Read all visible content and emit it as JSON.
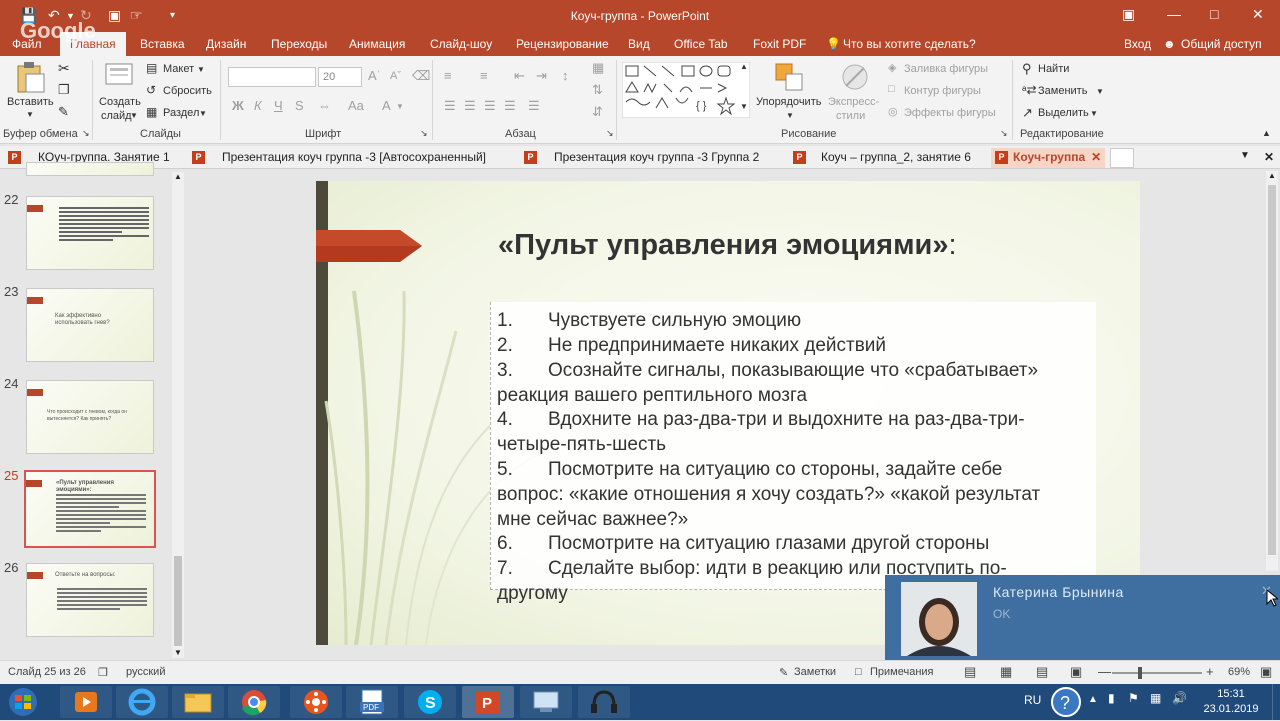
{
  "window": {
    "title": "Коуч-группа - PowerPoint"
  },
  "quick_access": {
    "google_watermark": "Google"
  },
  "menu": {
    "items": [
      "Файл",
      "Главная",
      "Вставка",
      "Дизайн",
      "Переходы",
      "Анимация",
      "Слайд-шоу",
      "Рецензирование",
      "Вид",
      "Office Tab",
      "Foxit PDF"
    ],
    "tell_me": "Что вы хотите сделать?",
    "signin": "Вход",
    "share": "Общий доступ"
  },
  "ribbon": {
    "clipboard": {
      "paste": "Вставить",
      "group": "Буфер обмена"
    },
    "slides": {
      "new_slide": "Создать",
      "new_slide2": "слайд",
      "layout": "Макет",
      "reset": "Сбросить",
      "section": "Раздел",
      "group": "Слайды"
    },
    "font": {
      "font_size": "20",
      "bold": "Ж",
      "italic": "К",
      "underline": "Ч",
      "strike": "S",
      "group": "Шрифт"
    },
    "paragraph": {
      "group": "Абзац"
    },
    "drawing": {
      "arrange": "Упорядочить",
      "quick_styles": "Экспресс-",
      "quick_styles2": "стили",
      "fill": "Заливка фигуры",
      "outline": "Контур фигуры",
      "effects": "Эффекты фигуры",
      "group": "Рисование"
    },
    "editing": {
      "find": "Найти",
      "replace": "Заменить",
      "select": "Выделить",
      "group": "Редактирование"
    }
  },
  "doc_tabs": [
    {
      "label": "КОуч-группа. Занятие 1"
    },
    {
      "label": "Презентация коуч группа -3 [Автосохраненный]"
    },
    {
      "label": "Презентация коуч группа -3 Группа 2"
    },
    {
      "label": "Коуч – группа_2, занятие 6"
    },
    {
      "label": "Коуч-группа"
    }
  ],
  "thumbnails": [
    {
      "num": "22",
      "text": ""
    },
    {
      "num": "23",
      "text": "Как эффективно использовать гнев?"
    },
    {
      "num": "24",
      "text": "Что происходит с гневом, когда он вытесняется? Как принять?"
    },
    {
      "num": "25",
      "text": "«Пульт управления эмоциями»:"
    },
    {
      "num": "26",
      "text": "Ответьте на вопросы:"
    }
  ],
  "slide": {
    "title": "«Пульт управления эмоциями»",
    "title_colon": ":",
    "items": [
      {
        "n": "1.",
        "text": "Чувствуете сильную эмоцию"
      },
      {
        "n": "2.",
        "text": "Не предпринимаете никаких действий"
      },
      {
        "n": "3.",
        "text": "Осознайте сигналы, показывающие что «срабатывает»"
      },
      {
        "n": "",
        "text": "реакция вашего рептильного мозга"
      },
      {
        "n": "4.",
        "text": "Вдохните на раз-два-три и выдохните на раз-два-три-"
      },
      {
        "n": "",
        "text": "четыре-пять-шесть"
      },
      {
        "n": "5.",
        "text": "Посмотрите на ситуацию со стороны, задайте себе"
      },
      {
        "n": "",
        "text": "вопрос: «какие отношения я хочу создать?» «какой результат"
      },
      {
        "n": "",
        "text": "мне сейчас важнее?»"
      },
      {
        "n": "6.",
        "text": "Посмотрите на ситуацию глазами другой стороны"
      },
      {
        "n": "7.",
        "text": "Сделайте выбор: идти в реакцию или поступить по-"
      },
      {
        "n": "",
        "text": "другому"
      }
    ]
  },
  "status": {
    "slide": "Слайд 25 из 26",
    "lang": "русский",
    "notes": "Заметки",
    "comments": "Примечания",
    "zoom": "69%"
  },
  "video": {
    "name": "Катерина  Брынина",
    "sub": "OK"
  },
  "taskbar": {
    "lang": "RU",
    "time": "15:31",
    "date": "23.01.2019"
  },
  "colors": {
    "accent": "#b7472a",
    "taskbar": "#1f4a7a",
    "video_panel": "#3f6fa0"
  }
}
